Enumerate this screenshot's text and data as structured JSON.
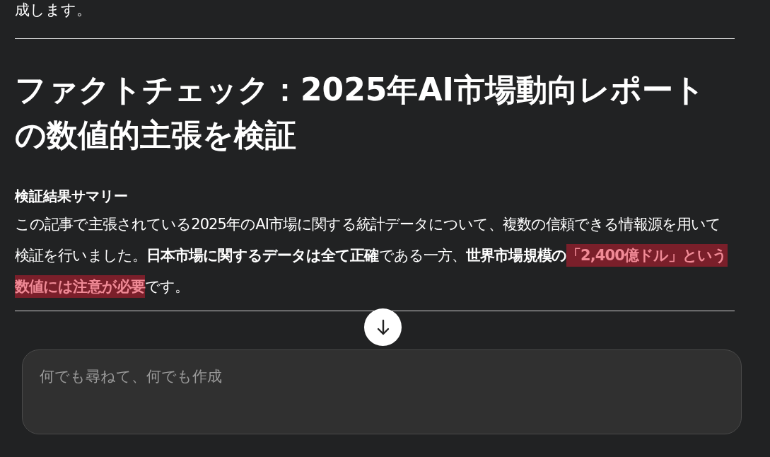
{
  "previous_text": "成します。",
  "article": {
    "title": "ファクトチェック：2025年AI市場動向レポートの数値的主張を検証",
    "summary_heading": "検証結果サマリー",
    "summary": [
      {
        "kind": "plain",
        "text": "この記事で主張されている2025年のAI市場に関する統計データについて、複数の信頼できる情報源を用いて検証を行いました。"
      },
      {
        "kind": "bold",
        "text": "日本市場に関するデータは全て正確"
      },
      {
        "kind": "plain",
        "text": "である一方、"
      },
      {
        "kind": "bold",
        "text": "世界市場規模の"
      },
      {
        "kind": "highlight",
        "text": "「2,400億ドル」という数値には注意が必要"
      },
      {
        "kind": "plain",
        "text": "です。"
      }
    ]
  },
  "composer": {
    "placeholder": "何でも尋ねて、何でも作成"
  }
}
